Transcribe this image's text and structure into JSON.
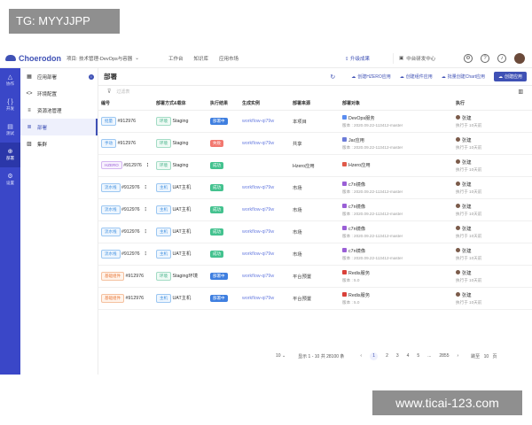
{
  "watermark": {
    "tag": "TG: MYYJJPP",
    "site": "www.ticai-123.com"
  },
  "topbar": {
    "logo": "Choerodon",
    "project": "项目: 技术管理-DevOps与容器",
    "nav": [
      "工作台",
      "知识库",
      "应用市场"
    ],
    "upgrade": "升级成果",
    "org": "中台研发中心",
    "icons": [
      "gear-icon",
      "help-icon",
      "bell-icon"
    ]
  },
  "leftnav": [
    {
      "label": "协作",
      "icon": "△"
    },
    {
      "label": "开发",
      "icon": "{ }"
    },
    {
      "label": "测试",
      "icon": "▤"
    },
    {
      "label": "部署",
      "icon": "⊕"
    },
    {
      "label": "设置",
      "icon": "⚙"
    }
  ],
  "subnav": [
    {
      "label": "应用部署",
      "icon": "▦"
    },
    {
      "label": "环境配置",
      "icon": "<>"
    },
    {
      "label": "资源池管理",
      "icon": "≡"
    },
    {
      "label": "部署",
      "icon": "≣"
    },
    {
      "label": "集群",
      "icon": "▨"
    }
  ],
  "main": {
    "title": "部署",
    "actions": [
      "创建HZERO应用",
      "创建组件应用",
      "批量创建Chart应用",
      "创建应用"
    ],
    "filter_placeholder": "过滤表",
    "columns": [
      "编号",
      "部署方式&载体",
      "执行结果",
      "生成实例",
      "部署来源",
      "部署对象",
      "执行"
    ],
    "rows": [
      {
        "type": "批量",
        "type_style": "blue",
        "id": "#912976",
        "carrier_tag": "环境",
        "carrier": "Staging",
        "result": "部署中",
        "result_style": "blue",
        "instance": "workflow-qi79w",
        "source": "本项目",
        "obj_icon": "#5b8def",
        "obj": "DevOps服务",
        "version": "版本 : 2020.09.22-113412-master",
        "user": "张建",
        "time": "执行于 10天前"
      },
      {
        "type": "手动",
        "type_style": "blue",
        "id": "#912976",
        "carrier_tag": "环境",
        "carrier": "Staging",
        "result": "失败",
        "result_style": "red",
        "instance": "workflow-qi79w",
        "source": "共享",
        "obj_icon": "#6b7bd8",
        "obj": "Jar应用",
        "version": "版本 : 2020.09.22-113412-master",
        "user": "张建",
        "time": "执行于 10天前"
      },
      {
        "type": "HZERO",
        "type_style": "purple",
        "id": "#912976",
        "carrier_tag": "环境",
        "carrier": "Staging",
        "result": "成功",
        "result_style": "green",
        "instance": "",
        "source": "Hzero应用",
        "obj_icon": "#e05a4a",
        "obj": "Hzero应用",
        "version": "",
        "user": "张建",
        "time": "执行于 10天前"
      },
      {
        "type": "流水线",
        "type_style": "blue",
        "id": "#912976",
        "carrier_tag": "主机",
        "carrier": "UAT主机",
        "result": "成功",
        "result_style": "green",
        "instance": "workflow-qi79w",
        "source": "市场",
        "obj_icon": "#9a5fd6",
        "obj": "c7n镜像",
        "version": "版本 : 2020.09.22-113412-master",
        "user": "张建",
        "time": "执行于 10天前"
      },
      {
        "type": "流水线",
        "type_style": "blue",
        "id": "#912976",
        "carrier_tag": "主机",
        "carrier": "UAT主机",
        "result": "成功",
        "result_style": "green",
        "instance": "workflow-qi79w",
        "source": "市场",
        "obj_icon": "#9a5fd6",
        "obj": "c7n镜像",
        "version": "版本 : 2020.09.22-113412-master",
        "user": "张建",
        "time": "执行于 10天前"
      },
      {
        "type": "流水线",
        "type_style": "blue",
        "id": "#912976",
        "carrier_tag": "主机",
        "carrier": "UAT主机",
        "result": "成功",
        "result_style": "green",
        "instance": "workflow-qi79w",
        "source": "市场",
        "obj_icon": "#9a5fd6",
        "obj": "c7n镜像",
        "version": "版本 : 2020.09.22-113412-master",
        "user": "张建",
        "time": "执行于 10天前"
      },
      {
        "type": "流水线",
        "type_style": "blue",
        "id": "#912976",
        "carrier_tag": "主机",
        "carrier": "UAT主机",
        "result": "成功",
        "result_style": "green",
        "instance": "workflow-qi79w",
        "source": "市场",
        "obj_icon": "#9a5fd6",
        "obj": "c7n镜像",
        "version": "版本 : 2020.09.22-113412-master",
        "user": "张建",
        "time": "执行于 10天前"
      },
      {
        "type": "基础组件",
        "type_style": "orange",
        "id": "#912976",
        "carrier_tag": "环境",
        "carrier": "Staging环境",
        "result": "部署中",
        "result_style": "blue",
        "instance": "workflow-qi79w",
        "source": "平台预置",
        "obj_icon": "#d9413a",
        "obj": "Redis服务",
        "version": "版本 : 5.0",
        "user": "张建",
        "time": "执行于 10天前"
      },
      {
        "type": "基础组件",
        "type_style": "orange",
        "id": "#912976",
        "carrier_tag": "主机",
        "carrier": "UAT主机",
        "result": "部署中",
        "result_style": "blue",
        "instance": "workflow-qi79w",
        "source": "平台预置",
        "obj_icon": "#d9413a",
        "obj": "Redis服务",
        "version": "版本 : 5.0",
        "user": "张建",
        "time": "执行于 10天前"
      }
    ],
    "pager": {
      "size": "10",
      "range": "显示 1 - 10 共 28100 条",
      "pages": [
        "1",
        "2",
        "3",
        "4",
        "5",
        "...",
        "2855"
      ],
      "jump_label": "跳至",
      "jump_value": "10",
      "jump_unit": "页"
    }
  }
}
